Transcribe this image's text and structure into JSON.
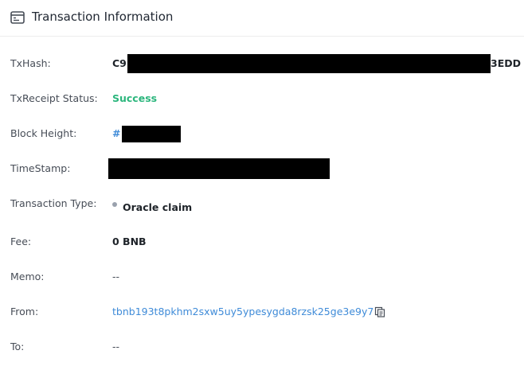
{
  "header": {
    "title": "Transaction Information",
    "icon": "card-icon"
  },
  "rows": {
    "txhash": {
      "label": "TxHash:",
      "value_start": "C91",
      "value_end": "3EDD"
    },
    "receipt_status": {
      "label": "TxReceipt Status:",
      "value": "Success"
    },
    "block_height": {
      "label": "Block Height:",
      "prefix": "#"
    },
    "timestamp": {
      "label": "TimeStamp:"
    },
    "transaction_type": {
      "label": "Transaction Type:",
      "value": "Oracle claim"
    },
    "fee": {
      "label": "Fee:",
      "value": "0 BNB"
    },
    "memo": {
      "label": "Memo:",
      "value": "--"
    },
    "from": {
      "label": "From:",
      "value": "tbnb193t8pkhm2sxw5uy5ypesygda8rzsk25ge3e9y7",
      "copy_icon": "copy-icon"
    },
    "to": {
      "label": "To:",
      "value": "--"
    }
  },
  "colors": {
    "success": "#2cb67d",
    "link": "#3f8bd8",
    "redaction": "#000000",
    "status_dot": "#9aa1ad"
  }
}
